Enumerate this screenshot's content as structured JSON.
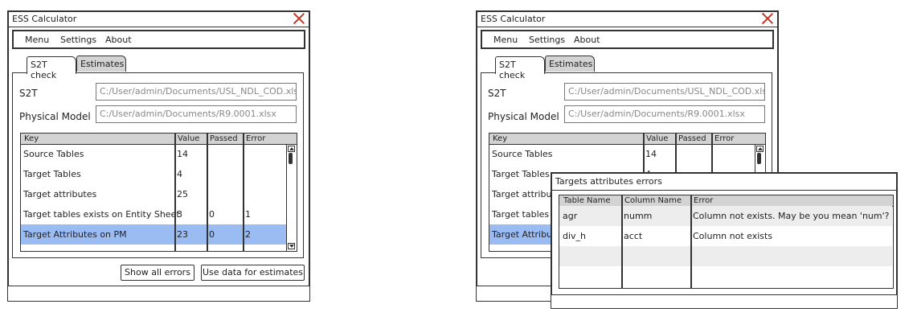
{
  "window": {
    "title": "ESS Calculator",
    "menu": [
      "Menu",
      "Settings",
      "About"
    ],
    "tabs": [
      "S2T check",
      "Estimates"
    ],
    "fields": {
      "s2t_label": "S2T",
      "s2t_value": "C:/User/admin/Documents/USL_NDL_COD.xlsx",
      "pm_label": "Physical Model",
      "pm_value": "C:/User/admin/Documents/R9.0001.xlsx"
    },
    "table": {
      "columns": [
        "Key",
        "Value",
        "Passed",
        "Error"
      ],
      "rows": [
        {
          "key": "Source Tables",
          "value": "14",
          "passed": "",
          "error": ""
        },
        {
          "key": "Target Tables",
          "value": "4",
          "passed": "",
          "error": ""
        },
        {
          "key": "Target attributes",
          "value": "25",
          "passed": "",
          "error": ""
        },
        {
          "key": "Target tables exists on Entity Sheet",
          "value": "3",
          "passed": "0",
          "error": "1"
        },
        {
          "key": "Target Attributes on PM",
          "value": "23",
          "passed": "0",
          "error": "2"
        }
      ],
      "selected_row": 4
    },
    "buttons": {
      "show_all_errors": "Show all errors",
      "use_data": "Use data for estimates"
    }
  },
  "right_window": {
    "title": "ESS Calculator",
    "rows_visible": [
      {
        "key": "Source Tables",
        "value": "14"
      },
      {
        "key": "Target Tables",
        "value": "4"
      },
      {
        "key": "Target attribute",
        "value": ""
      },
      {
        "key": "Target tables e",
        "value": ""
      },
      {
        "key": "Target Attribute",
        "value": ""
      }
    ]
  },
  "error_dialog": {
    "title": "Targets attributes errors",
    "columns": [
      "Table Name",
      "Column Name",
      "Error"
    ],
    "rows": [
      {
        "table": "agr",
        "column": "numm",
        "error": "Column not exists. May be you mean 'num'?"
      },
      {
        "table": "div_h",
        "column": "acct",
        "error": "Column not exists"
      }
    ]
  },
  "colors": {
    "selected_row": "#9bbcf3",
    "header": "#d3d3d3",
    "alt_row": "#ededed",
    "close_icon": "#c0392b"
  },
  "icons": [
    "close-icon",
    "scroll-up-icon",
    "scroll-down-icon"
  ]
}
